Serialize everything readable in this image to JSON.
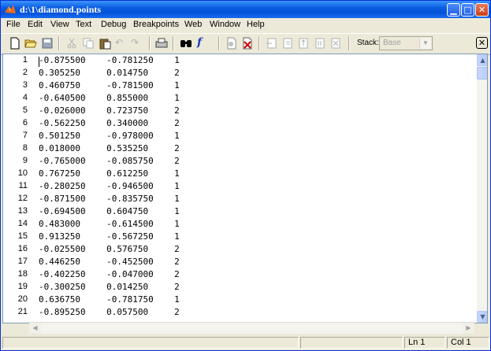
{
  "window": {
    "title": "d:\\1\\diamond.points"
  },
  "menu": [
    "File",
    "Edit",
    "View",
    "Text",
    "Debug",
    "Breakpoints",
    "Web",
    "Window",
    "Help"
  ],
  "toolbar": {
    "icons": [
      "new-file-icon",
      "open-folder-icon",
      "save-icon",
      "cut-icon",
      "copy-icon",
      "paste-icon",
      "undo-icon",
      "redo-icon",
      "print-icon",
      "find-icon",
      "function-icon",
      "set-breakpoint-icon",
      "clear-breakpoints-icon",
      "step-icon",
      "step-in-icon",
      "step-out-icon",
      "continue-icon",
      "exit-debug-icon"
    ],
    "stack_label": "Stack:",
    "stack_value": "Base"
  },
  "editor": {
    "lines": [
      "-0.875500    -0.781250    1",
      "0.305250     0.014750     2",
      "0.460750     -0.781500    1",
      "-0.640500    0.855000     1",
      "-0.026000    0.723750     2",
      "-0.562250    0.340000     2",
      "0.501250     -0.978000    1",
      "0.018000     0.535250     2",
      "-0.765000    -0.085750    2",
      "0.767250     0.612250     1",
      "-0.280250    -0.946500    1",
      "-0.871500    -0.835750    1",
      "-0.694500    0.604750     1",
      "0.483000     -0.614500    1",
      "0.913250     -0.567250    1",
      "-0.025500    0.576750     2",
      "0.446250     -0.452500    2",
      "-0.402250    -0.047000    2",
      "-0.300250    0.014250     2",
      "0.636750     -0.781750    1",
      "-0.895250    0.057500     2"
    ],
    "line_numbers": [
      "1",
      "2",
      "3",
      "4",
      "5",
      "6",
      "7",
      "8",
      "9",
      "10",
      "11",
      "12",
      "13",
      "14",
      "15",
      "16",
      "17",
      "18",
      "19",
      "20",
      "21"
    ]
  },
  "status": {
    "line": "Ln 1",
    "col": "Col 1"
  }
}
